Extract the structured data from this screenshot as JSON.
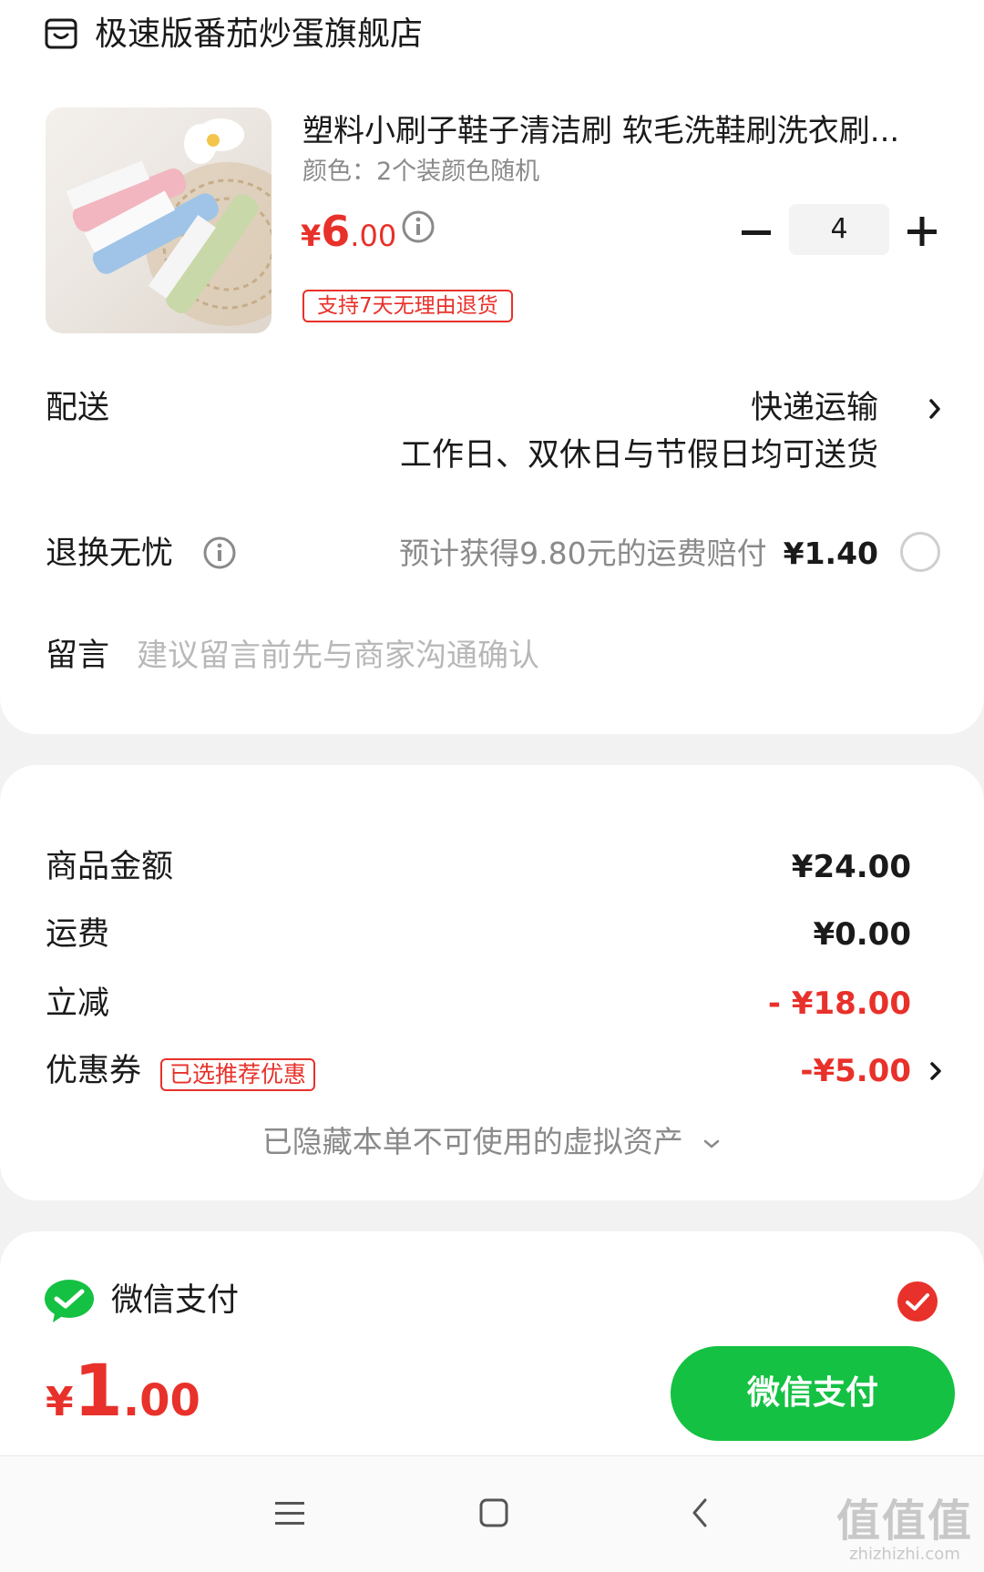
{
  "store": {
    "name": "极速版番茄炒蛋旗舰店",
    "icon": "store-icon"
  },
  "product": {
    "title": "塑料小刷子鞋子清洁刷 软毛洗鞋刷洗衣刷...",
    "variant": "颜色：2个装颜色随机",
    "price_symbol": "¥",
    "price_int": "6",
    "price_dec": ".00",
    "quantity": "4",
    "return_tag": "支持7天无理由退货"
  },
  "shipping": {
    "label": "配送",
    "method": "快递运输",
    "note": "工作日、双休日与节假日均可送货"
  },
  "return_insurance": {
    "label": "退换无忧",
    "desc": "预计获得9.80元的运费赔付",
    "price": "¥1.40"
  },
  "message": {
    "label": "留言",
    "placeholder": "建议留言前先与商家沟通确认"
  },
  "summary": {
    "goods_label": "商品金额",
    "goods_value": "¥24.00",
    "freight_label": "运费",
    "freight_value": "¥0.00",
    "discount_label": "立减",
    "discount_value": "- ¥18.00",
    "coupon_label": "优惠券",
    "coupon_tag": "已选推荐优惠",
    "coupon_value": "-¥5.00",
    "hidden_assets": "已隐藏本单不可使用的虚拟资产"
  },
  "payment": {
    "method": "微信支付"
  },
  "bottom": {
    "total_symbol": "¥",
    "total_int": "1",
    "total_dec": ".00",
    "pay_button": "微信支付"
  },
  "watermark": {
    "main": "值值值",
    "sub": "zhizhizhi.com"
  },
  "colors": {
    "accent_red": "#e8312a",
    "wechat_green": "#14c142",
    "muted": "#8a8a8a"
  }
}
